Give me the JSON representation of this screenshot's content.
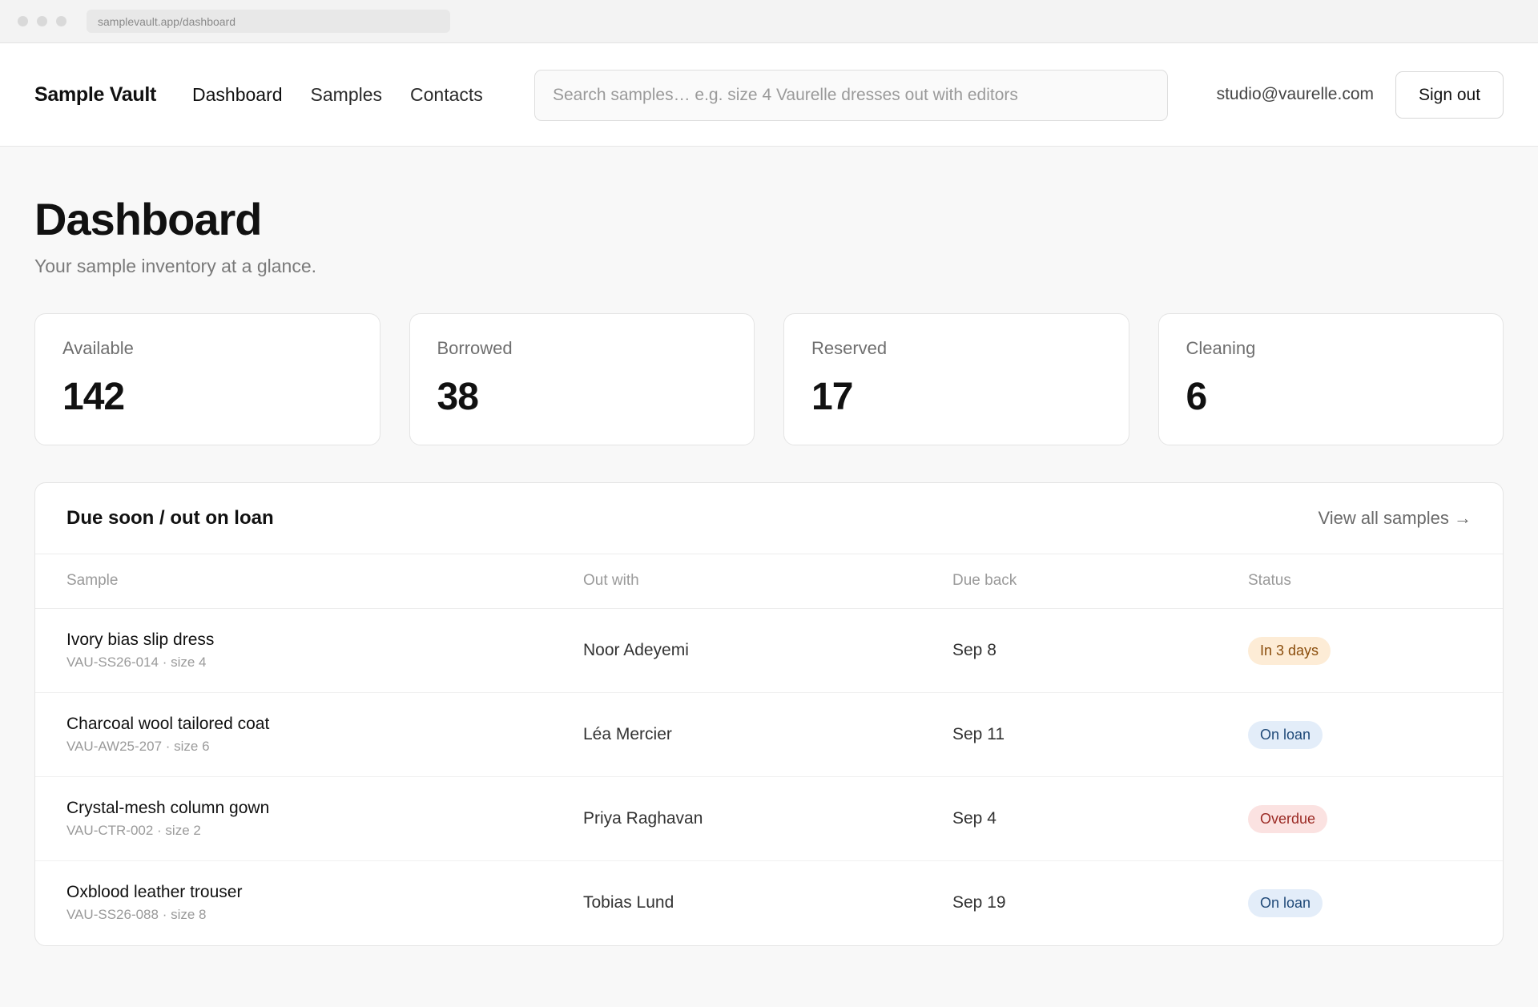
{
  "browser": {
    "url": "samplevault.app/dashboard"
  },
  "header": {
    "brand": "Sample Vault",
    "nav": [
      {
        "label": "Dashboard",
        "active": true
      },
      {
        "label": "Samples",
        "active": false
      },
      {
        "label": "Contacts",
        "active": false
      }
    ],
    "search_placeholder": "Search samples… e.g. size 4 Vaurelle dresses out with editors",
    "user_email": "studio@vaurelle.com",
    "signout_label": "Sign out"
  },
  "page": {
    "title": "Dashboard",
    "subtitle": "Your sample inventory at a glance."
  },
  "stats": [
    {
      "label": "Available",
      "value": "142"
    },
    {
      "label": "Borrowed",
      "value": "38"
    },
    {
      "label": "Reserved",
      "value": "17"
    },
    {
      "label": "Cleaning",
      "value": "6"
    }
  ],
  "loans": {
    "title": "Due soon / out on loan",
    "view_all_label": "View all samples →",
    "columns": [
      "Sample",
      "Out with",
      "Due back",
      "Status"
    ],
    "rows": [
      {
        "name": "Ivory bias slip dress",
        "meta": "VAU-SS26-014 · size 4",
        "out_with": "Noor Adeyemi",
        "due": "Sep 8",
        "status": "In 3 days",
        "status_color": "amber"
      },
      {
        "name": "Charcoal wool tailored coat",
        "meta": "VAU-AW25-207 · size 6",
        "out_with": "Léa Mercier",
        "due": "Sep 11",
        "status": "On loan",
        "status_color": "blue"
      },
      {
        "name": "Crystal-mesh column gown",
        "meta": "VAU-CTR-002 · size 2",
        "out_with": "Priya Raghavan",
        "due": "Sep 4",
        "status": "Overdue",
        "status_color": "red"
      },
      {
        "name": "Oxblood leather trouser",
        "meta": "VAU-SS26-088 · size 8",
        "out_with": "Tobias Lund",
        "due": "Sep 19",
        "status": "On loan",
        "status_color": "blue"
      }
    ]
  },
  "colors": {
    "amber_bg": "#fdecd6",
    "blue_bg": "#e3edf9",
    "red_bg": "#fbe2e1"
  }
}
